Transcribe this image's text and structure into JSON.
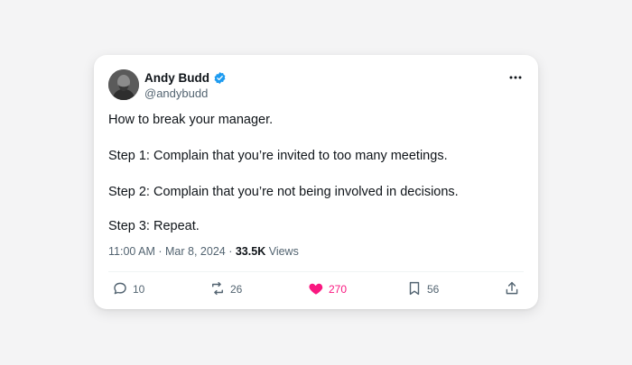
{
  "author": {
    "name": "Andy Budd",
    "handle": "@andybudd"
  },
  "tweet": {
    "lines": [
      "How to break your manager.",
      "Step 1: Complain that you’re invited to too many meetings.",
      "Step 2: Complain that you’re not being involved in decisions.",
      "Step 3: Repeat."
    ],
    "time": "11:00 AM",
    "date": "Mar 8, 2024",
    "views_count": "33.5K",
    "views_label": "Views"
  },
  "actions": {
    "replies": "10",
    "retweets": "26",
    "likes": "270",
    "bookmarks": "56"
  },
  "colors": {
    "verified": "#1d9bf0",
    "like": "#f91880",
    "muted": "#536471"
  }
}
